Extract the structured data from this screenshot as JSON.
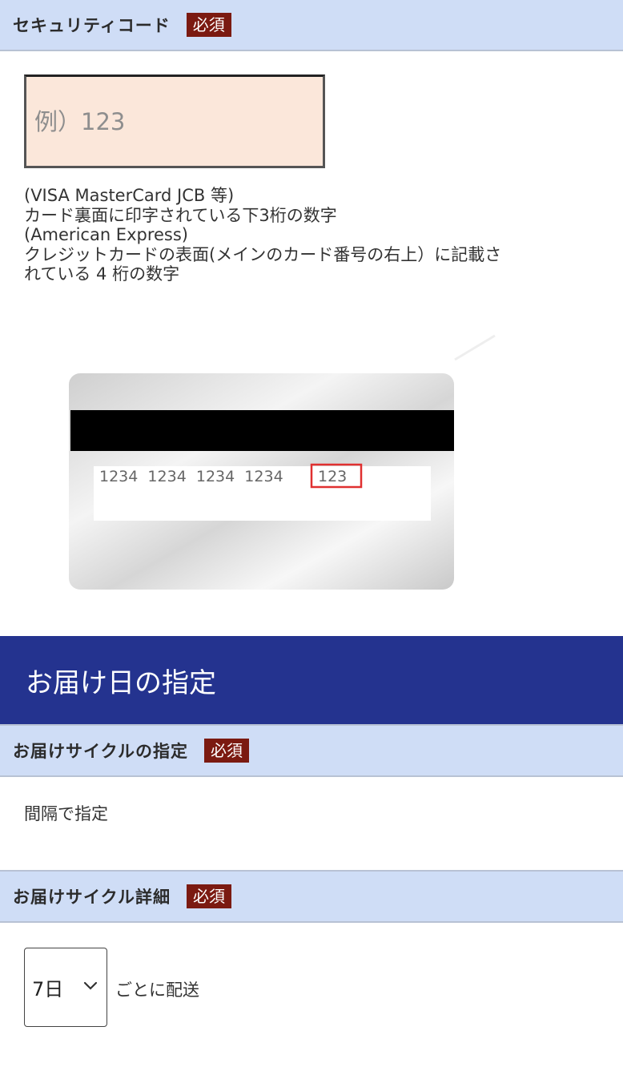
{
  "security": {
    "title": "セキュリティコード",
    "required": "必須",
    "placeholder": "例）123",
    "notes": [
      "(VISA MasterCard JCB 等)",
      "カード裏面に印字されている下3桁の数字",
      "(American Express)",
      "クレジットカードの表面(メインのカード番号の右上）に記載さ",
      "れている 4 桁の数字"
    ],
    "card": {
      "numbers": "1234  1234  1234  1234",
      "code": "123",
      "highlight_color": "#e03030"
    }
  },
  "delivery": {
    "band_title": "お届け日の指定",
    "band_color": "#24338f",
    "cycle": {
      "title": "お届けサイクルの指定",
      "required": "必須",
      "value": "間隔で指定"
    },
    "detail": {
      "title": "お届けサイクル詳細",
      "required": "必須",
      "selected": "7日",
      "suffix": "ごとに配送",
      "icon": "chevron-down-icon"
    }
  },
  "colors": {
    "header_bg": "#cfddf6",
    "badge_bg": "#7b1a11",
    "input_bg": "#fbe7da"
  }
}
